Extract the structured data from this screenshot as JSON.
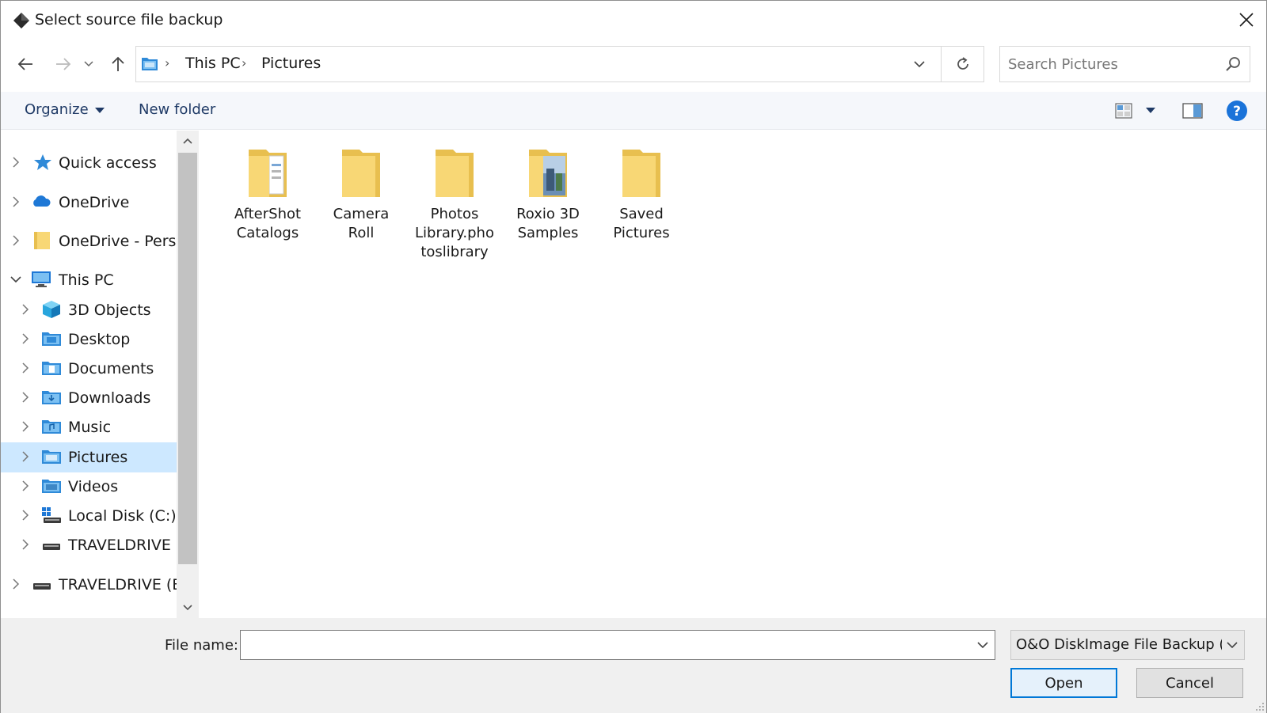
{
  "window": {
    "title": "Select source file backup"
  },
  "nav": {
    "breadcrumbs": [
      "This PC",
      "Pictures"
    ],
    "search_placeholder": "Search Pictures"
  },
  "toolbar": {
    "organize_label": "Organize",
    "new_folder_label": "New folder"
  },
  "tree": {
    "items": [
      {
        "label": "Quick access",
        "icon": "star-icon",
        "expanded": false
      },
      {
        "label": "OneDrive",
        "icon": "cloud-icon",
        "expanded": false
      },
      {
        "label": "OneDrive - Persor",
        "icon": "folder-icon",
        "expanded": false
      },
      {
        "label": "This PC",
        "icon": "computer-icon",
        "expanded": true
      },
      {
        "label": "3D Objects",
        "icon": "cube-icon",
        "expanded": false
      },
      {
        "label": "Desktop",
        "icon": "desktop-folder-icon",
        "expanded": false
      },
      {
        "label": "Documents",
        "icon": "documents-folder-icon",
        "expanded": false
      },
      {
        "label": "Downloads",
        "icon": "downloads-folder-icon",
        "expanded": false
      },
      {
        "label": "Music",
        "icon": "music-folder-icon",
        "expanded": false
      },
      {
        "label": "Pictures",
        "icon": "pictures-folder-icon",
        "expanded": false,
        "selected": true
      },
      {
        "label": "Videos",
        "icon": "videos-folder-icon",
        "expanded": false
      },
      {
        "label": "Local Disk (C:)",
        "icon": "drive-c-icon",
        "expanded": false
      },
      {
        "label": "TRAVELDRIVE (E:",
        "icon": "usb-drive-icon",
        "expanded": false
      },
      {
        "label": "TRAVELDRIVE (E:)",
        "icon": "usb-drive-icon",
        "expanded": false
      }
    ]
  },
  "files": [
    {
      "lines": [
        "AfterShot",
        "Catalogs"
      ],
      "icon": "folder-with-files-icon"
    },
    {
      "lines": [
        "Camera",
        "Roll"
      ],
      "icon": "folder-icon"
    },
    {
      "lines": [
        "Photos",
        "Library.pho",
        "toslibrary"
      ],
      "icon": "folder-icon"
    },
    {
      "lines": [
        "Roxio 3D",
        "Samples"
      ],
      "icon": "folder-with-photo-icon"
    },
    {
      "lines": [
        "Saved",
        "Pictures"
      ],
      "icon": "folder-icon"
    }
  ],
  "bottom": {
    "file_name_label": "File name:",
    "file_name_value": "",
    "filter_value": "O&O DiskImage File Backup (*.",
    "open_label": "Open",
    "cancel_label": "Cancel"
  },
  "colors": {
    "accent": "#0078d7",
    "selection": "#cde8ff",
    "folder": "#f8d775",
    "toolbar_text": "#1f3a66"
  }
}
